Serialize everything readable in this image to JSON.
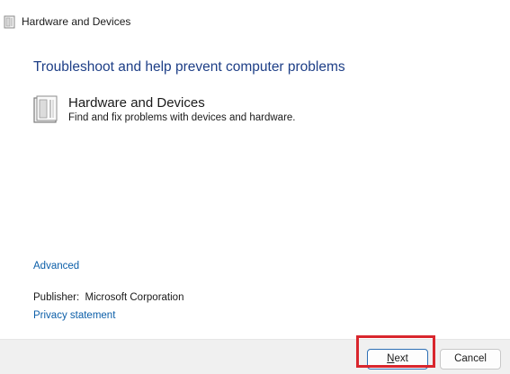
{
  "window": {
    "title": "Hardware and Devices",
    "icon": "hardware-devices-icon"
  },
  "main": {
    "heading": "Troubleshoot and help prevent computer problems",
    "item": {
      "icon": "hardware-devices-icon",
      "title": "Hardware and Devices",
      "description": "Find and fix problems with devices and hardware."
    },
    "advanced_link": "Advanced",
    "publisher": {
      "label": "Publisher:",
      "value": "Microsoft Corporation"
    },
    "privacy_link": "Privacy statement"
  },
  "footer": {
    "next_accel": "N",
    "next_rest": "ext",
    "cancel_label": "Cancel"
  },
  "colors": {
    "heading": "#1e3f87",
    "link": "#0b5ea8",
    "highlight": "#d9262d",
    "footer_bg": "#f0f0f0"
  }
}
